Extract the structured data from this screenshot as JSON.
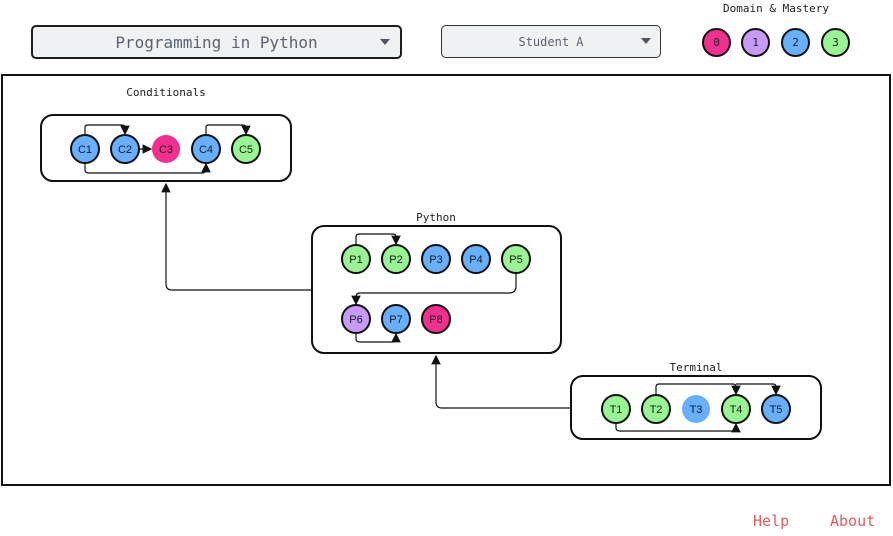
{
  "header": {
    "course_select": {
      "value": "Programming in Python",
      "icon": "caret-down-icon"
    },
    "student_select": {
      "value": "Student A",
      "icon": "caret-down-icon"
    },
    "legend": {
      "title": "Domain & Mastery",
      "levels": [
        {
          "label": "0",
          "color": "#f22f8f"
        },
        {
          "label": "1",
          "color": "#c89af8"
        },
        {
          "label": "2",
          "color": "#66b0ff"
        },
        {
          "label": "3",
          "color": "#99f593"
        }
      ]
    }
  },
  "graph": {
    "domains": [
      {
        "id": "conditionals",
        "title": "Conditionals",
        "nodes": [
          {
            "id": "C1",
            "mastery": 2
          },
          {
            "id": "C2",
            "mastery": 2
          },
          {
            "id": "C3",
            "mastery": 0,
            "unassessed": true
          },
          {
            "id": "C4",
            "mastery": 2
          },
          {
            "id": "C5",
            "mastery": 3
          }
        ],
        "edges": [
          [
            "C1",
            "C2"
          ],
          [
            "C1",
            "C4"
          ],
          [
            "C2",
            "C3"
          ],
          [
            "C4",
            "C5"
          ]
        ]
      },
      {
        "id": "python",
        "title": "Python",
        "nodes": [
          {
            "id": "P1",
            "mastery": 3
          },
          {
            "id": "P2",
            "mastery": 3
          },
          {
            "id": "P3",
            "mastery": 2
          },
          {
            "id": "P4",
            "mastery": 2
          },
          {
            "id": "P5",
            "mastery": 3
          },
          {
            "id": "P6",
            "mastery": 1
          },
          {
            "id": "P7",
            "mastery": 2
          },
          {
            "id": "P8",
            "mastery": 0
          }
        ],
        "edges": [
          [
            "P1",
            "P2"
          ],
          [
            "P5",
            "P6"
          ],
          [
            "P6",
            "P7"
          ]
        ]
      },
      {
        "id": "terminal",
        "title": "Terminal",
        "nodes": [
          {
            "id": "T1",
            "mastery": 3
          },
          {
            "id": "T2",
            "mastery": 3
          },
          {
            "id": "T3",
            "mastery": 2,
            "unassessed": true
          },
          {
            "id": "T4",
            "mastery": 3
          },
          {
            "id": "T5",
            "mastery": 2
          }
        ],
        "edges": [
          [
            "T1",
            "T4"
          ],
          [
            "T2",
            "T4"
          ],
          [
            "T2",
            "T5"
          ]
        ]
      }
    ],
    "domain_edges": [
      [
        "python",
        "conditionals"
      ],
      [
        "terminal",
        "python"
      ]
    ]
  },
  "footer": {
    "help": "Help",
    "about": "About"
  }
}
